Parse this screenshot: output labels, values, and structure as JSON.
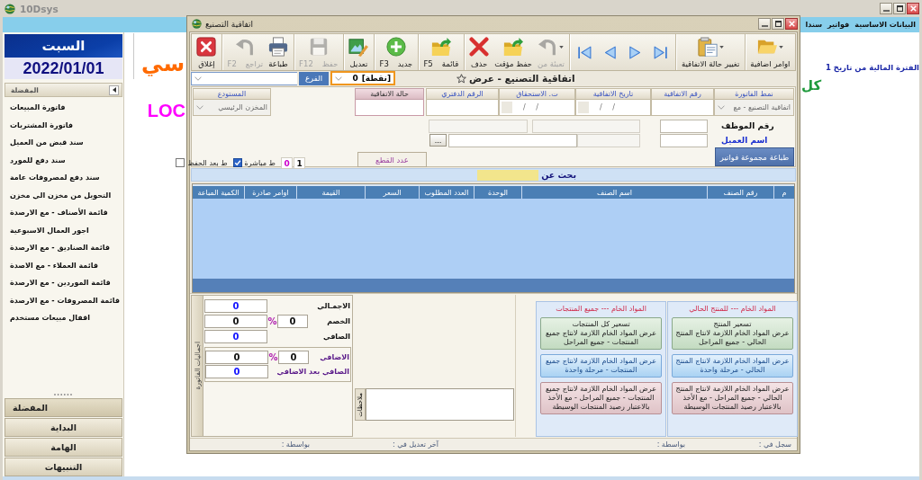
{
  "app": {
    "title": "10Dsys",
    "menu": [
      "البيانات الاساسية",
      "فواتير",
      "سندا"
    ],
    "heading_fragment": "سي",
    "logo_fragment": "LOC",
    "period": "الفترة المالية من تاريخ 1",
    "subheading_fragment": "كل"
  },
  "sidebar": {
    "day": "السبت",
    "date": "2022/01/01",
    "header": "المفضلة",
    "items": [
      "فاتورة المبيعات",
      "فاتورة المشتريات",
      "سند قبض من العميل",
      "سند دفع للمورد",
      "سند دفع لمصروفات عامة",
      "التحويل من مخزن الي مخزن",
      "قائمة الأصناف - مع الارصدة",
      "اجور العمال الاسبوعية",
      "قائمة الصناديق - مع الارصدة",
      "قائمة العملاء - مع الاصدة",
      "قائمة الموردين - مع الارصدة",
      "قائمة المصروفات - مع الارصدة",
      "اقفال مبيعات مستخدم"
    ],
    "nav": [
      {
        "label": "المفضلة",
        "selected": true
      },
      {
        "label": "البداية",
        "selected": false
      },
      {
        "label": "الهامة",
        "selected": false
      },
      {
        "label": "التنبيهات",
        "selected": false
      }
    ]
  },
  "window": {
    "title": "اتفاقية التصنيع",
    "branch": {
      "label": "الفرع"
    },
    "point": {
      "label": "[نقطة]",
      "value": "0"
    },
    "heading": "اتفاقية التصنيع - عرض"
  },
  "toolbar": [
    [
      {
        "kind": "more",
        "label": "اوامر اضافية",
        "disabled": false,
        "menu": true
      }
    ],
    [
      {
        "kind": "status",
        "label": "تغيير حالة الاتفاقية",
        "disabled": false,
        "menu": true
      }
    ],
    [
      {
        "kind": "last",
        "disabled": false,
        "menu": false
      },
      {
        "kind": "next",
        "disabled": false,
        "menu": false
      },
      {
        "kind": "prev",
        "disabled": false,
        "menu": false
      },
      {
        "kind": "first",
        "disabled": false,
        "menu": false
      }
    ],
    [
      {
        "kind": "fill",
        "label": "تعبئة من",
        "disabled": true,
        "menu": true
      },
      {
        "kind": "draft",
        "label": "حفظ مؤقت",
        "disabled": false,
        "menu": false
      },
      {
        "kind": "delete",
        "label": "حذف",
        "disabled": false,
        "menu": false
      }
    ],
    [
      {
        "kind": "list",
        "label": "قائمة",
        "shortcut": "F5",
        "disabled": false,
        "menu": false
      }
    ],
    [
      {
        "kind": "new",
        "label": "جديد",
        "shortcut": "F3",
        "disabled": false,
        "menu": false
      }
    ],
    [
      {
        "kind": "edit",
        "label": "تعديل",
        "disabled": false,
        "menu": false
      }
    ],
    [
      {
        "kind": "save",
        "label": "حفظ",
        "shortcut": "F12",
        "disabled": true,
        "menu": false
      }
    ],
    [
      {
        "kind": "print",
        "label": "طباعة",
        "disabled": false,
        "menu": false
      },
      {
        "kind": "undo",
        "label": "تراجع",
        "shortcut": "F2",
        "disabled": true,
        "menu": false
      }
    ],
    [
      {
        "kind": "close",
        "label": "إغلاق",
        "disabled": false,
        "menu": false
      }
    ]
  ],
  "form": {
    "fields": [
      {
        "kind": "dropdown",
        "label": "نمط الفاتورة",
        "value": "اتفاقية التصنيع - مع"
      },
      {
        "kind": "text",
        "label": "رقم الاتفاقية"
      },
      {
        "kind": "date",
        "label": "تاريخ الاتفاقية",
        "value": "/ /"
      },
      {
        "kind": "date",
        "label": "ت. الاستحقاق",
        "value": "/ /"
      },
      {
        "kind": "text",
        "label": "الرقم الدفتري"
      }
    ],
    "status": {
      "label": "حالة الاتفاقية"
    },
    "warehouse": {
      "label": "المستودع",
      "value": "المخزن الرئيسي"
    },
    "employee_label": "رقم الموظف",
    "customer_label": "اسم العميل",
    "browse": "...",
    "print_group": "طباعة مجموعة فواتير",
    "pieces_label": "عدد القطع",
    "counters": [
      {
        "value": "1",
        "color": "#111111"
      },
      {
        "value": "0",
        "color": "#cc00cc"
      }
    ],
    "options": [
      {
        "label": "ط مباشرة",
        "checked": true
      },
      {
        "label": "ط بعد الحفظ",
        "checked": false
      }
    ],
    "search_label": "بحث عن"
  },
  "table": {
    "columns": [
      "م",
      "رقم الصنف",
      "اسم الصنف",
      "الوحدة",
      "العدد المطلوب",
      "السعر",
      "القيمة",
      "اوامر صادرة",
      "الكمية المباعة"
    ]
  },
  "totals": {
    "tab": "اجماليات الفاتورة",
    "rows": [
      {
        "kind": "total",
        "label": "الاجمـالي",
        "value": "0"
      },
      {
        "kind": "percent",
        "label": "الخصم",
        "percent": "0",
        "symbol": "%",
        "value": "0"
      },
      {
        "kind": "net",
        "label": "الصافي",
        "value": "0"
      }
    ],
    "extras": [
      {
        "kind": "percent",
        "label": "الاضافي",
        "percent": "0",
        "symbol": "%",
        "value": "0"
      },
      {
        "kind": "net",
        "label": "الصافي بعد الاضافي",
        "value": "0"
      }
    ]
  },
  "notes": {
    "label": "ملاحظات"
  },
  "materials": [
    {
      "title": "المواد الخام --- للمنتج الحالي",
      "buttons": [
        {
          "kind": "pricing",
          "title": "تسعير المنتج",
          "label": "عرض المواد الخام اللازمة لانتاج المنتج الحالي - جميع المراحل"
        },
        {
          "kind": "one_stage",
          "label": "عرض المواد الخام اللازمة لانتاج المنتج الحالي - مرحلة واحدة"
        },
        {
          "kind": "all_stages",
          "label": "عرض المواد الخام اللازمة لانتاج المنتج الحالي - جميع المراحل - مع الأخذ بالاعتبار رصيد المنتجات الوسيطة"
        }
      ]
    },
    {
      "title": "المواد الخام --- جميع المنتجات",
      "buttons": [
        {
          "kind": "pricing",
          "title": "تسعير كل المنتجات",
          "label": "عرض المواد الخام اللازمة لانتاج جميع المنتجات - جميع المراحل"
        },
        {
          "kind": "one_stage",
          "label": "عرض المواد الخام اللازمة لانتاج جميع المنتجات - مرحلة واحدة"
        },
        {
          "kind": "all_stages",
          "label": "عرض المواد الخام اللازمة لانتاج جميع المنتجات - جميع المراحل - مع الأخذ بالاعتبار رصيد المنتجات الوسيطة"
        }
      ]
    }
  ],
  "audit": [
    "سجل في :",
    "بواسطة :",
    "آخر تعديل في :",
    "بواسطة :"
  ]
}
